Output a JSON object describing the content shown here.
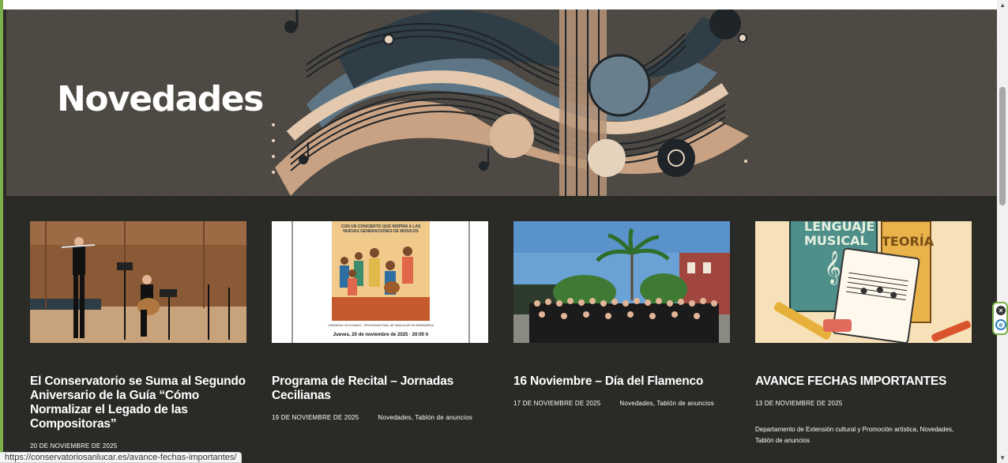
{
  "hero": {
    "title": "Novedades"
  },
  "posts": [
    {
      "title": "El Conservatorio se Suma al Segundo Aniversario de la Guía “Cómo Normalizar el Legado de las Compositoras”",
      "date": "20 DE NOVIEMBRE DE 2025",
      "categories": ""
    },
    {
      "title": "Programa de Recital – Jornadas Cecilianas",
      "date": "19 DE NOVIEMBRE DE 2025",
      "categories": "Novedades, Tablón de anuncios",
      "poster_top": "CON UN CONCIERTO QUE INSPIRA A LAS NUEVAS GENERACIONES DE MÚSICOS",
      "poster_small": "JORNADAS CECILIANAS – PROGRAMA FINAL DE SANLÚCAR DE BARRAMEDA",
      "poster_date": "Jueves, 20 de noviembre de 2025 · 20:00 h"
    },
    {
      "title": "16 Noviembre – Día del Flamenco",
      "date": "17 DE NOVIEMBRE DE 2025",
      "categories": "Novedades, Tablón de anuncios"
    },
    {
      "title": "AVANCE FECHAS IMPORTANTES",
      "date": "13 DE NOVIEMBRE DE 2025",
      "categories": "Departamento de Extensión cultural y Promoción artística, Novedades, Tablón de anuncios",
      "book_1": "LENGUAJE MUSICAL",
      "book_2": "TEORÍA"
    }
  ],
  "status_bar": {
    "url": "https://conservatoriosanlucar.es/avance-fechas-importantes/"
  },
  "colors": {
    "background": "#2a2b27",
    "accent_border": "#7bb04a"
  },
  "icons": {
    "close": "close-icon",
    "extension": "e-extension-icon"
  }
}
